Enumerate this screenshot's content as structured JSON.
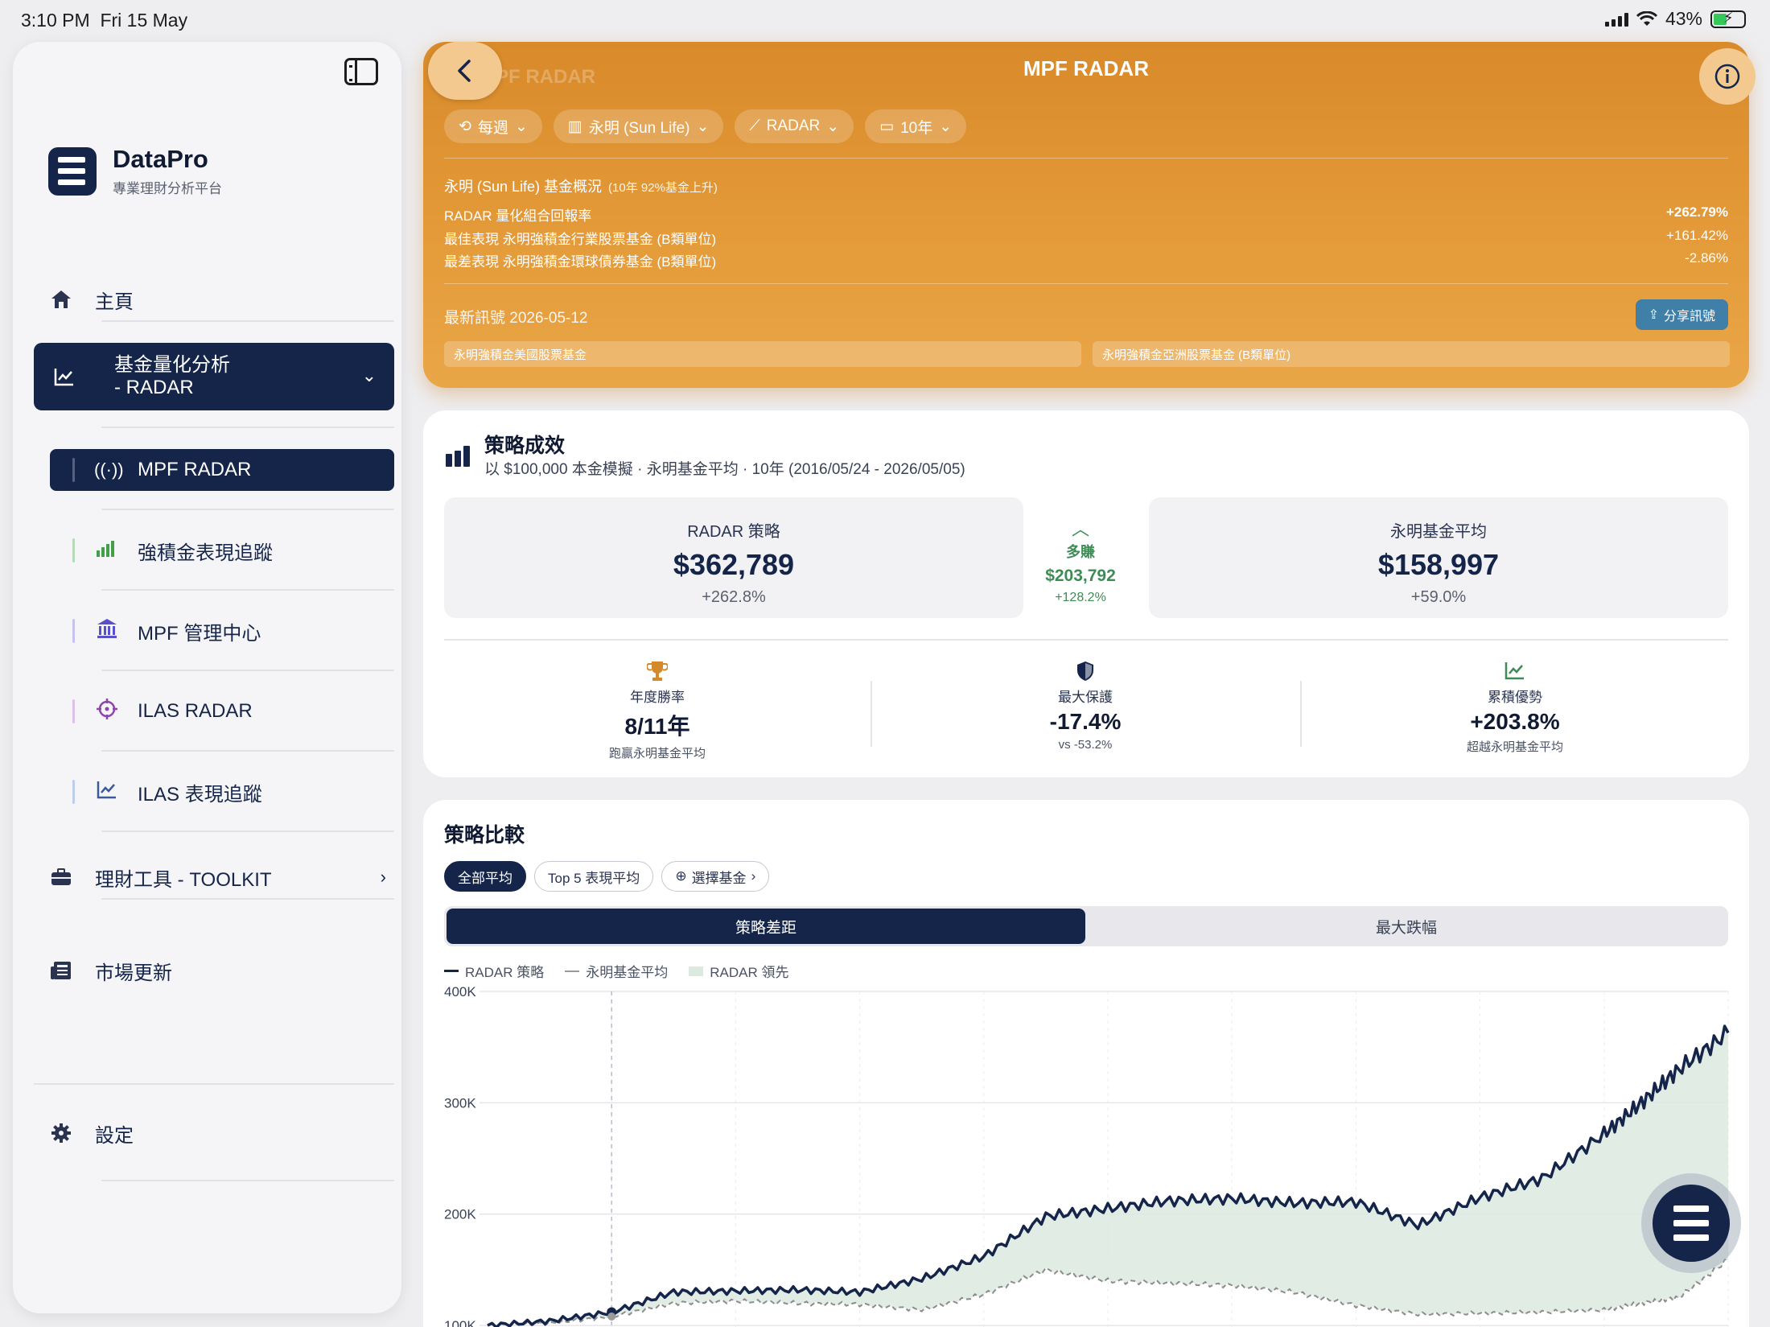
{
  "status_bar": {
    "time": "3:10 PM",
    "date": "Fri 15 May",
    "battery": "43%"
  },
  "sidebar": {
    "brand_name": "DataPro",
    "brand_sub": "專業理財分析平台",
    "home": "主頁",
    "radar_group_line1": "基金量化分析",
    "radar_group_line2": "- RADAR",
    "sub_items": [
      "MPF RADAR",
      "強積金表現追蹤",
      "MPF 管理中心",
      "ILAS RADAR",
      "ILAS 表現追蹤"
    ],
    "toolkit": "理財工具 - TOOLKIT",
    "market": "市場更新",
    "settings": "設定"
  },
  "header": {
    "title": "MPF RADAR",
    "chips": [
      "每週",
      "永明 (Sun Life)",
      "RADAR",
      "10年"
    ],
    "overview_title": "永明 (Sun Life) 基金概況",
    "overview_note": "(10年 92%基金上升)",
    "rows": [
      {
        "label": "RADAR 量化組合回報率",
        "value": "+262.79%"
      },
      {
        "label": "最佳表現 永明強積金行業股票基金 (B類單位)",
        "value": "+161.42%"
      },
      {
        "label": "最差表現 永明強積金環球債券基金 (B類單位)",
        "value": "-2.86%"
      }
    ],
    "signal_label": "最新訊號 2026-05-12",
    "share_label": "分享訊號",
    "signal_funds": [
      "永明強積金美國股票基金",
      "永明強積金亞洲股票基金 (B類單位)"
    ]
  },
  "performance": {
    "title": "策略成效",
    "subtitle": "以 $100,000 本金模擬 · 永明基金平均 · 10年 (2016/05/24 - 2026/05/05)",
    "radar": {
      "title": "RADAR 策略",
      "value": "$362,789",
      "pct": "+262.8%"
    },
    "diff": {
      "label": "多賺",
      "value": "$203,792",
      "pct": "+128.2%"
    },
    "avg": {
      "title": "永明基金平均",
      "value": "$158,997",
      "pct": "+59.0%"
    },
    "kpis": [
      {
        "title": "年度勝率",
        "value": "8/11年",
        "sub": "跑贏永明基金平均"
      },
      {
        "title": "最大保護",
        "value": "-17.4%",
        "sub": "vs -53.2%"
      },
      {
        "title": "累積優勢",
        "value": "+203.8%",
        "sub": "超越永明基金平均"
      }
    ]
  },
  "comparison": {
    "title": "策略比較",
    "filters": [
      "全部平均",
      "Top 5 表現平均",
      "選擇基金"
    ],
    "tabs": [
      "策略差距",
      "最大跌幅"
    ],
    "legend": [
      "RADAR 策略",
      "永明基金平均",
      "RADAR 領先"
    ]
  },
  "chart_data": {
    "type": "line",
    "title": "",
    "xlabel": "",
    "ylabel": "",
    "ylim": [
      95000,
      400000
    ],
    "yticks": [
      "100K",
      "200K",
      "300K",
      "400K"
    ],
    "ytick_values": [
      100000,
      200000,
      300000,
      400000
    ],
    "x_range": [
      "2016/05/24",
      "2026/05/05"
    ],
    "x": [
      0,
      0.05,
      0.1,
      0.15,
      0.2,
      0.25,
      0.3,
      0.35,
      0.4,
      0.45,
      0.5,
      0.55,
      0.6,
      0.65,
      0.7,
      0.75,
      0.8,
      0.85,
      0.9,
      0.93,
      0.96,
      1.0
    ],
    "series": [
      {
        "name": "RADAR 策略",
        "color": "#15254a",
        "values": [
          100000,
          104000,
          112000,
          130000,
          131000,
          132000,
          130000,
          142000,
          162000,
          198000,
          205000,
          212000,
          214000,
          210000,
          211000,
          190000,
          215000,
          232000,
          272000,
          300000,
          330000,
          362789
        ]
      },
      {
        "name": "永明基金平均",
        "color": "#8c8c8c",
        "values": [
          100000,
          102000,
          108000,
          120000,
          122000,
          120000,
          119000,
          114000,
          128000,
          150000,
          140000,
          138000,
          136000,
          130000,
          118000,
          110000,
          111000,
          112000,
          114000,
          120000,
          125000,
          158997
        ]
      }
    ],
    "area": {
      "name": "RADAR 領先",
      "color": "#dbe9df"
    },
    "grid": true
  },
  "colors": {
    "navy": "#15254a",
    "orange": "#e49a38",
    "green": "#3d8c55"
  }
}
